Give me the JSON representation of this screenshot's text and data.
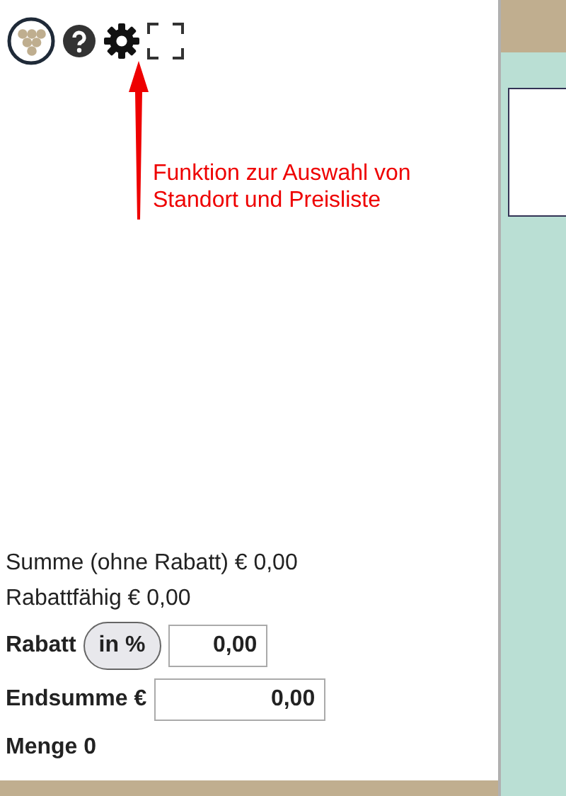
{
  "annotation": {
    "lines": [
      "Funktion zur Auswahl von",
      "Standort und Preisliste"
    ]
  },
  "summary": {
    "lines": [
      "Summe (ohne Rabatt) € 0,00",
      "Rabattfähig € 0,00"
    ],
    "discount": {
      "label": "Rabatt",
      "mode_button": "in %",
      "value": "0,00"
    },
    "total": {
      "label": "Endsumme €",
      "value": "0,00"
    },
    "quantity": "Menge 0"
  }
}
